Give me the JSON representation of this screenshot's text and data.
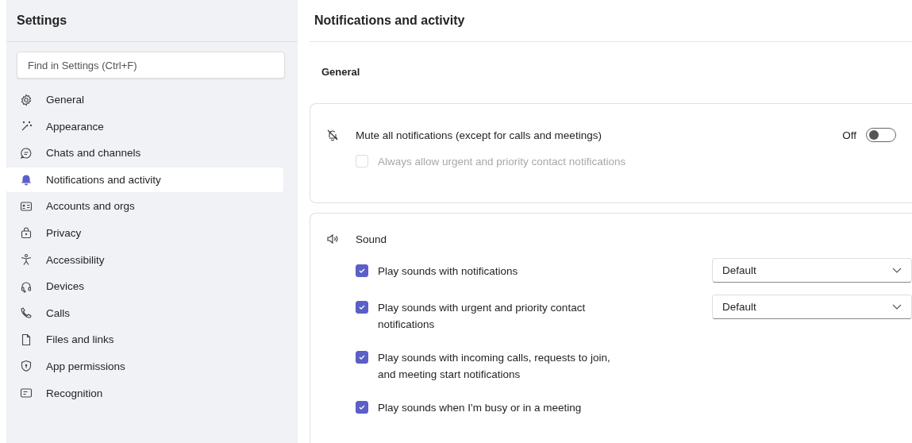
{
  "sidebar": {
    "title": "Settings",
    "search": {
      "placeholder": "Find in Settings (Ctrl+F)"
    },
    "items": [
      {
        "label": "General",
        "selected": false
      },
      {
        "label": "Appearance",
        "selected": false
      },
      {
        "label": "Chats and channels",
        "selected": false
      },
      {
        "label": "Notifications and activity",
        "selected": true
      },
      {
        "label": "Accounts and orgs",
        "selected": false
      },
      {
        "label": "Privacy",
        "selected": false
      },
      {
        "label": "Accessibility",
        "selected": false
      },
      {
        "label": "Devices",
        "selected": false
      },
      {
        "label": "Calls",
        "selected": false
      },
      {
        "label": "Files and links",
        "selected": false
      },
      {
        "label": "App permissions",
        "selected": false
      },
      {
        "label": "Recognition",
        "selected": false
      }
    ]
  },
  "main": {
    "title": "Notifications and activity",
    "section": "General",
    "mute": {
      "label": "Mute all notifications (except for calls and meetings)",
      "toggle_label": "Off",
      "on": false,
      "option": {
        "label": "Always allow urgent and priority contact notifications",
        "checked": false,
        "disabled": true
      }
    },
    "sound": {
      "title": "Sound",
      "options": [
        {
          "label": "Play sounds with notifications",
          "checked": true,
          "dropdown": "Default"
        },
        {
          "label": "Play sounds with urgent and priority contact notifications",
          "checked": true,
          "dropdown": "Default"
        },
        {
          "label": "Play sounds with incoming calls, requests to join, and meeting start notifications",
          "checked": true
        },
        {
          "label": "Play sounds when I'm busy or in a meeting",
          "checked": true
        }
      ]
    }
  }
}
